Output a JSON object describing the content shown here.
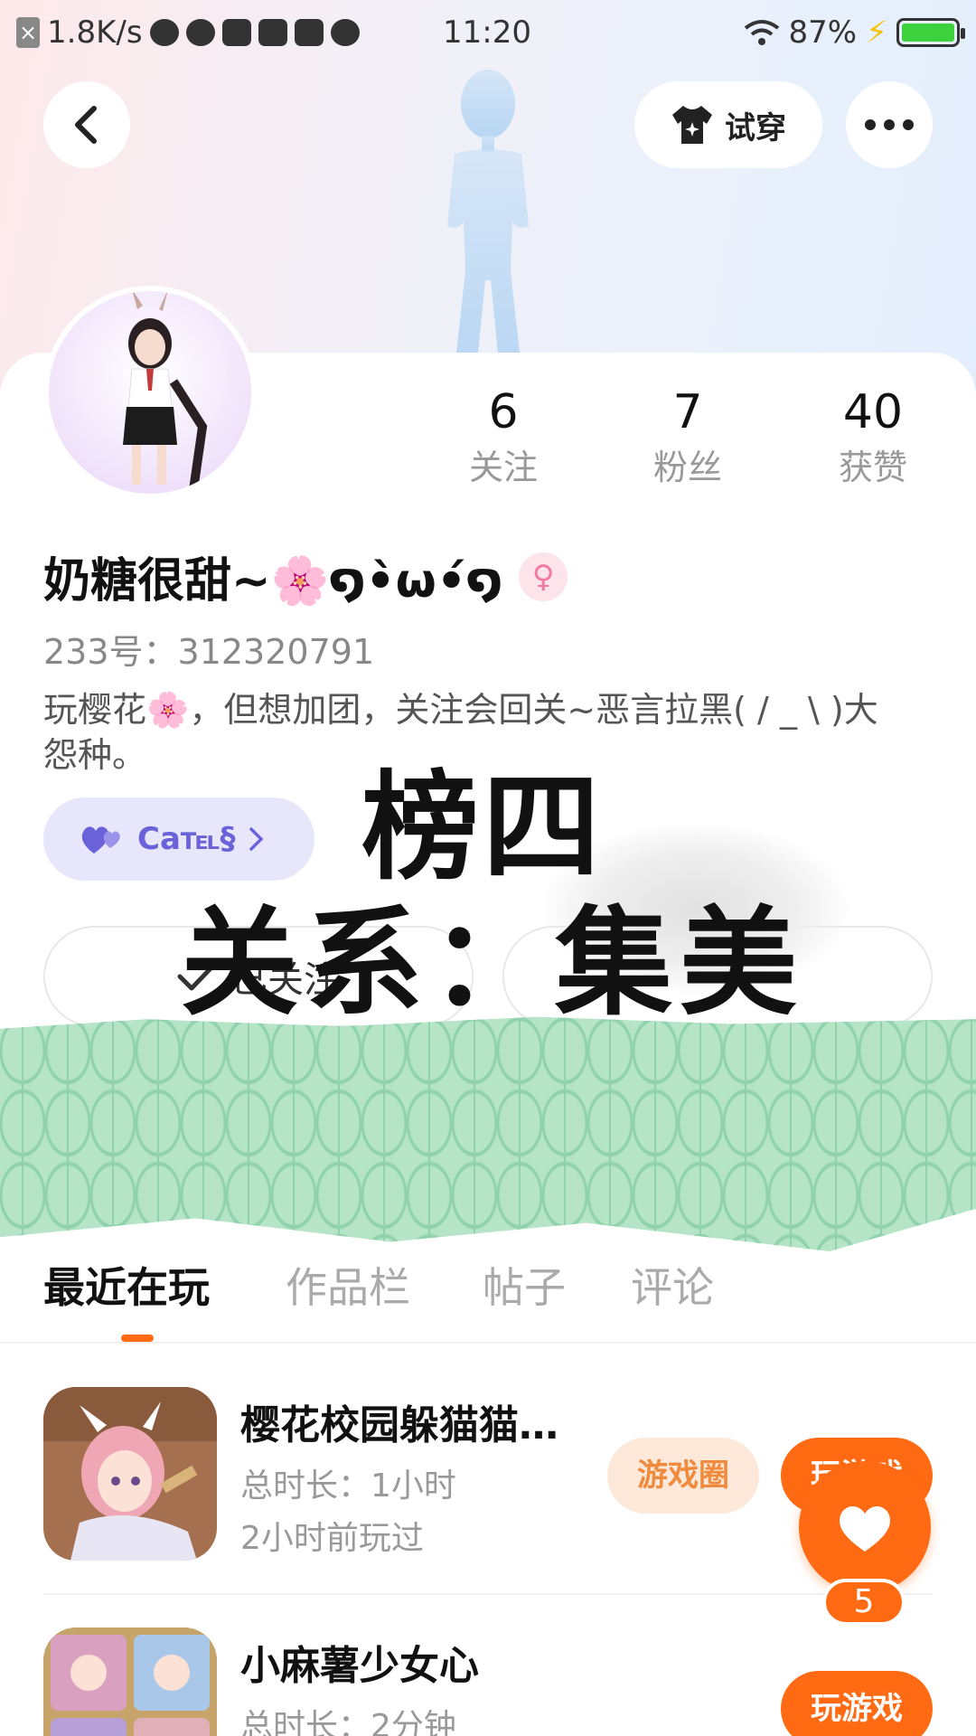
{
  "status_bar": {
    "speed": "1.8K/s",
    "time": "11:20",
    "battery": "87%"
  },
  "header": {
    "tryon_label": "试穿"
  },
  "profile": {
    "nickname": "奶糖很甜~🌸໑•̀ω•́໑",
    "gender_symbol": "♀",
    "user_id": "233号：312320791",
    "bio": "玩樱花🌸，但想加团，关注会回关~恶言拉黑( / _ \\ )大怨种。",
    "tag_text": "Ca℡§",
    "stats": [
      {
        "value": "6",
        "label": "关注"
      },
      {
        "value": "7",
        "label": "粉丝"
      },
      {
        "value": "40",
        "label": "获赞"
      }
    ],
    "follow_label": "已关注"
  },
  "overlay": {
    "line1": "榜四",
    "line2": "关系：集美"
  },
  "tabs": [
    {
      "label": "最近在玩",
      "active": true
    },
    {
      "label": "作品栏",
      "active": false
    },
    {
      "label": "帖子",
      "active": false
    },
    {
      "label": "评论",
      "active": false
    }
  ],
  "games": [
    {
      "title": "樱花校园躲猫猫…",
      "duration": "总时长：1小时",
      "last_played": "2小时前玩过",
      "circle_label": "游戏圈",
      "play_label": "玩游戏"
    },
    {
      "title": "小麻薯少女心",
      "duration": "总时长：2分钟",
      "play_label": "玩游戏"
    }
  ],
  "like_fab": {
    "count": "5"
  },
  "colors": {
    "accent": "#ff6a13",
    "tag_purple": "#6b62d9",
    "leaf_green": "#b6e4c7"
  }
}
